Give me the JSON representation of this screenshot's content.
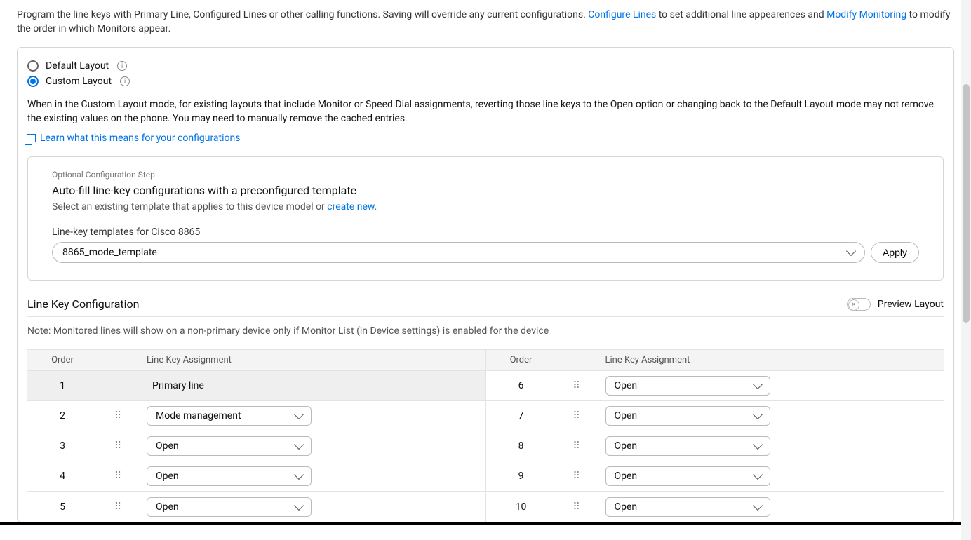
{
  "intro": {
    "text_a": "Program the line keys with Primary Line, Configured Lines or other calling functions. Saving will override any current configurations. ",
    "link_configure": "Configure Lines",
    "text_b": " to set additional line appearences and ",
    "link_modify": "Modify Monitoring",
    "text_c": " to modify the order in which Monitors appear."
  },
  "layout": {
    "default_label": "Default Layout",
    "custom_label": "Custom Layout",
    "selected": "custom",
    "custom_desc": "When in the Custom Layout mode, for existing layouts that include Monitor or Speed Dial assignments, reverting those line keys to the Open option or changing back to the Default Layout mode may not remove the existing values on the phone. You may need to manually remove the cached entries.",
    "learn_link": "Learn what this means for your configurations"
  },
  "template": {
    "step_label": "Optional Configuration Step",
    "title": "Auto-fill line-key configurations with a preconfigured template",
    "subtitle_a": "Select an existing template that applies to this device model or ",
    "subtitle_link": "create new",
    "subtitle_b": ".",
    "field_label": "Line-key templates for Cisco 8865",
    "selected_template": "8865_mode_template",
    "apply_label": "Apply"
  },
  "lineKeyConfig": {
    "section_title": "Line Key Configuration",
    "preview_label": "Preview Layout",
    "note": "Note: Monitored lines will show on a non-primary device only if Monitor List (in Device settings) is enabled for the device",
    "th_order": "Order",
    "th_assign": "Line Key Assignment",
    "left": [
      {
        "order": "1",
        "type": "primary",
        "text": "Primary line"
      },
      {
        "order": "2",
        "type": "select",
        "value": "Mode management"
      },
      {
        "order": "3",
        "type": "select",
        "value": "Open"
      },
      {
        "order": "4",
        "type": "select",
        "value": "Open"
      },
      {
        "order": "5",
        "type": "select",
        "value": "Open"
      }
    ],
    "right": [
      {
        "order": "6",
        "type": "select",
        "value": "Open"
      },
      {
        "order": "7",
        "type": "select",
        "value": "Open"
      },
      {
        "order": "8",
        "type": "select",
        "value": "Open"
      },
      {
        "order": "9",
        "type": "select",
        "value": "Open"
      },
      {
        "order": "10",
        "type": "select",
        "value": "Open"
      }
    ]
  }
}
